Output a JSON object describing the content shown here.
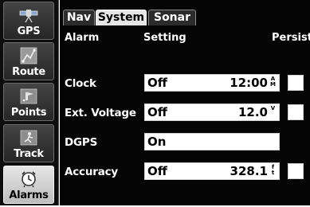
{
  "sidebar": {
    "items": [
      {
        "label": "GPS",
        "icon": "satellite-icon",
        "active": false
      },
      {
        "label": "Route",
        "icon": "route-icon",
        "active": false
      },
      {
        "label": "Points",
        "icon": "points-icon",
        "active": false
      },
      {
        "label": "Track",
        "icon": "track-icon",
        "active": false
      },
      {
        "label": "Alarms",
        "icon": "alarm-clock-icon",
        "active": true
      }
    ]
  },
  "tabs": [
    {
      "label": "Nav",
      "active": false
    },
    {
      "label": "System",
      "active": true
    },
    {
      "label": "Sonar",
      "active": false
    }
  ],
  "columns": {
    "alarm": "Alarm",
    "setting": "Setting",
    "persist": "Persist"
  },
  "alarms": [
    {
      "label": "Clock",
      "state": "Off",
      "value": "12:00",
      "unit": "A\nM",
      "persist": false
    },
    {
      "label": "Ext. Voltage",
      "state": "Off",
      "value": "12.0",
      "unit": "V",
      "persist": false
    },
    {
      "label": "DGPS",
      "state": "On",
      "value": "",
      "unit": "",
      "persist": null
    },
    {
      "label": "Accuracy",
      "state": "Off",
      "value": "328.1",
      "unit": "f\nt",
      "persist": false
    }
  ],
  "colors": {
    "background": "#050505",
    "field": "#ffffff",
    "active_tab": "#e6e6e6",
    "text": "#ffffff"
  }
}
